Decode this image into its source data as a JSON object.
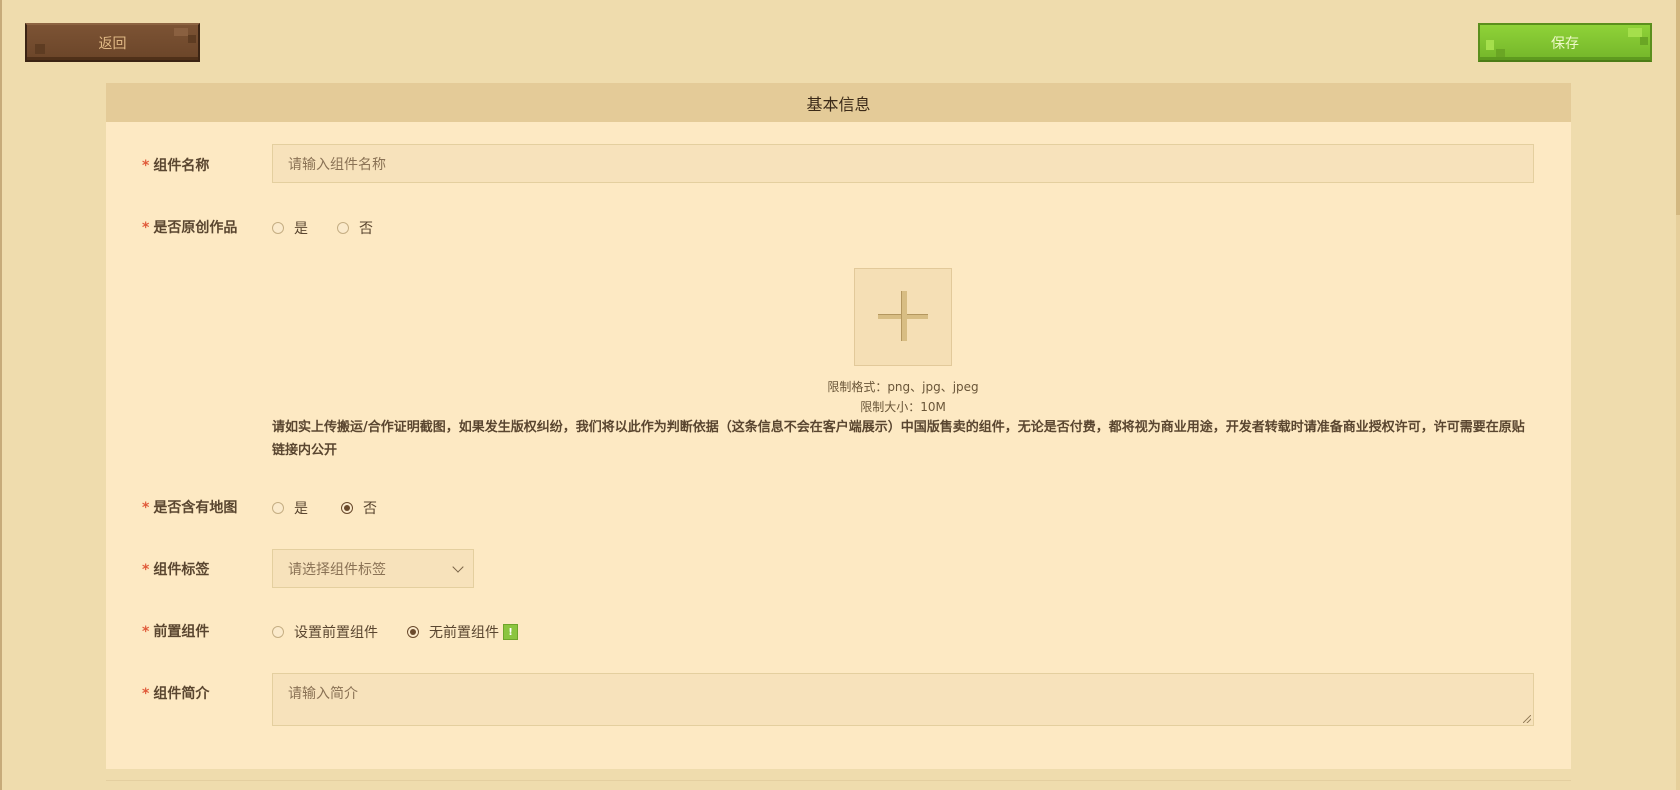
{
  "toolbar": {
    "back_label": "返回",
    "save_label": "保存"
  },
  "form": {
    "section_title": "基本信息",
    "required_mark": "*",
    "name": {
      "label": "组件名称",
      "placeholder": "请输入组件名称"
    },
    "original": {
      "label": "是否原创作品",
      "options": [
        "是",
        "否"
      ],
      "selected": null
    },
    "upload": {
      "icon": "plus-icon",
      "format_hint": "限制格式：png、jpg、jpeg",
      "size_hint": "限制大小：10M",
      "notice": "请如实上传搬运/合作证明截图，如果发生版权纠纷，我们将以此作为判断依据（这条信息不会在客户端展示）中国版售卖的组件，无论是否付费，都将视为商业用途，开发者转载时请准备商业授权许可，许可需要在原贴链接内公开"
    },
    "has_map": {
      "label": "是否含有地图",
      "options": [
        "是",
        "否"
      ],
      "selected": "否"
    },
    "tags": {
      "label": "组件标签",
      "placeholder": "请选择组件标签",
      "icon": "chevron-down-icon"
    },
    "prerequisite": {
      "label": "前置组件",
      "options": [
        "设置前置组件",
        "无前置组件"
      ],
      "selected": "无前置组件",
      "badge": "!",
      "badge_color": "#8bc53f"
    },
    "intro": {
      "label": "组件简介",
      "placeholder": "请输入简介"
    }
  },
  "colors": {
    "background": "#efdcad",
    "panel": "#fde9c3",
    "header": "#e4cb98",
    "back_button": "#6b4529",
    "save_button": "#7bbd2e",
    "required": "#e05a3a"
  }
}
